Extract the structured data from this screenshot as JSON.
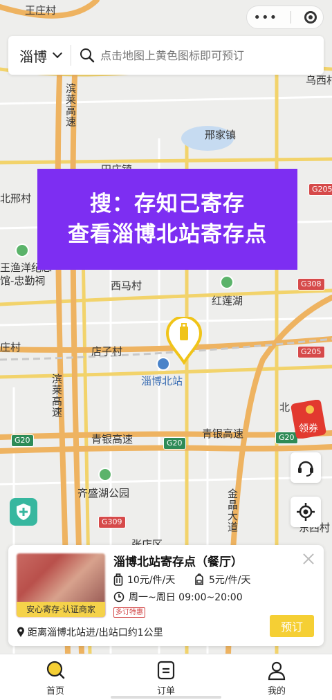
{
  "header": {
    "city": "淄博",
    "search_placeholder": "点击地图上黄色图标即可预订"
  },
  "promo": {
    "line1": "搜：存知己寄存",
    "line2": "查看淄博北站寄存点"
  },
  "map": {
    "labels": {
      "wangzhuang": "王庄村",
      "wuxi": "乌西村",
      "binlai_top": "滨莱高速",
      "xingjia": "邢家镇",
      "tianzhuang": "田庄镇",
      "beixing": "北邢村",
      "wangyu": "王渔洋纪念",
      "zhongqin": "馆-忠勤祠",
      "xima": "西马村",
      "honglian": "红莲湖",
      "zhuangcun": "庄村",
      "dianzi": "店子村",
      "station": "淄博北站",
      "binlai_mid": "滨莱高速",
      "qingyin_left": "青银高速",
      "qingyin_right": "青银高速",
      "qisheng": "齐盛湖公园",
      "jinjing": "金晶大道",
      "zhang": "张店区",
      "bei": "北",
      "dongsi": "东西村"
    },
    "shields": {
      "g205_top": "G205",
      "g308": "G308",
      "g205_mid": "G205",
      "g20_left": "G20",
      "g20_mid": "G20",
      "g20_right": "G20",
      "g309": "G309"
    }
  },
  "coupon": {
    "label": "领券"
  },
  "card": {
    "title": "淄博北站寄存点（餐厅）",
    "badge": "安心寄存·认证商家",
    "price_luggage": "10元/件/天",
    "price_bag": "5元/件/天",
    "hours": "周一~周日 09:00~20:00",
    "tag": "多订特惠",
    "distance": "距离淄博北站进/出站口约1公里",
    "book_label": "预订"
  },
  "tabs": [
    {
      "label": "首页",
      "icon": "search-icon"
    },
    {
      "label": "订单",
      "icon": "orders-icon"
    },
    {
      "label": "我的",
      "icon": "user-icon"
    }
  ],
  "colors": {
    "accent": "#f5cf34",
    "promo_bg": "#7d2ef2",
    "shield_red": "#d64a4a",
    "shield_green": "#2e8b57"
  }
}
